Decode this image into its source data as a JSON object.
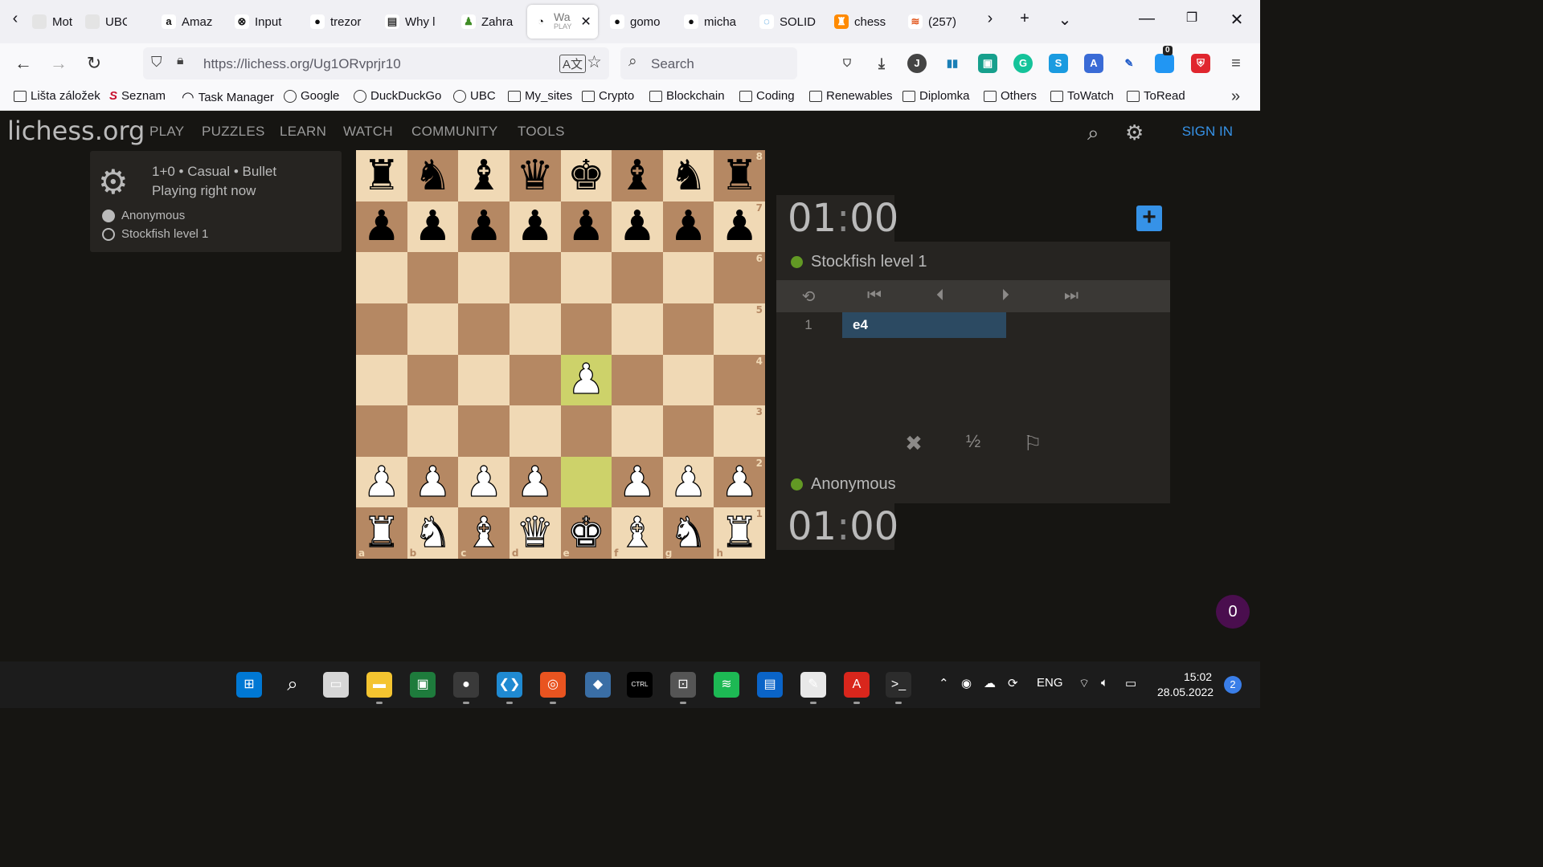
{
  "browser": {
    "tabs": [
      {
        "label": "Moto",
        "icon": "motor-icon",
        "color": "#ffffff"
      },
      {
        "label": "UBC",
        "icon": "ubc-icon",
        "color": "#ffffff"
      },
      {
        "label": "Amaz",
        "icon": "amazon-icon",
        "color": "#ffffff"
      },
      {
        "label": "Input",
        "icon": "github-icon",
        "color": "#ffffff"
      },
      {
        "label": "trezor",
        "icon": "github-icon",
        "color": "#ffffff"
      },
      {
        "label": "Why l",
        "icon": "book-icon",
        "color": "#ffffff"
      },
      {
        "label": "Zahra",
        "icon": "pawn-icon",
        "color": "#ffffff"
      },
      {
        "label": "Wa",
        "sublabel": "PLAY",
        "icon": "lichess-icon",
        "active": true
      },
      {
        "label": "gomo",
        "icon": "github-icon"
      },
      {
        "label": "micha",
        "icon": "github-icon"
      },
      {
        "label": "SOLID",
        "icon": "solid-icon"
      },
      {
        "label": "chess",
        "icon": "chess-icon"
      },
      {
        "label": "(257)",
        "icon": "flame-icon"
      }
    ],
    "url": "https://lichess.org/Ug1ORvprjr10",
    "search_placeholder": "Search",
    "extension_badge": "0",
    "bookmarks": [
      {
        "label": "Lišta záložek",
        "icon": "folder-icon"
      },
      {
        "label": "Seznam",
        "icon": "seznam-icon"
      },
      {
        "label": "Task Manager",
        "icon": "gauge-icon"
      },
      {
        "label": "Google",
        "icon": "globe-icon"
      },
      {
        "label": "DuckDuckGo",
        "icon": "globe-icon"
      },
      {
        "label": "UBC",
        "icon": "globe-icon"
      },
      {
        "label": "My_sites",
        "icon": "folder-icon"
      },
      {
        "label": "Crypto",
        "icon": "folder-icon"
      },
      {
        "label": "Blockchain",
        "icon": "folder-icon"
      },
      {
        "label": "Coding",
        "icon": "folder-icon"
      },
      {
        "label": "Renewables",
        "icon": "folder-icon"
      },
      {
        "label": "Diplomka",
        "icon": "folder-icon"
      },
      {
        "label": "Others",
        "icon": "folder-icon"
      },
      {
        "label": "ToWatch",
        "icon": "folder-icon"
      },
      {
        "label": "ToRead",
        "icon": "folder-icon"
      }
    ]
  },
  "site": {
    "logo": "lichess.org",
    "menu": [
      "PLAY",
      "PUZZLES",
      "LEARN",
      "WATCH",
      "COMMUNITY",
      "TOOLS"
    ],
    "signin": "SIGN IN"
  },
  "game": {
    "line1": "1+0 • Casual • Bullet",
    "line2": "Playing right now",
    "white_player": "Anonymous",
    "black_player": "Stockfish level 1",
    "top_clock_min": "01",
    "top_clock_sec": "00",
    "bottom_clock_min": "01",
    "bottom_clock_sec": "00",
    "top_player": "Stockfish level 1",
    "bottom_player": "Anonymous",
    "moves": [
      {
        "number": "1",
        "white": "e4"
      }
    ],
    "draw_label": "½",
    "chat_badge": "0"
  },
  "board": {
    "ranks": [
      "8",
      "7",
      "6",
      "5",
      "4",
      "3",
      "2",
      "1"
    ],
    "files": [
      "a",
      "b",
      "c",
      "d",
      "e",
      "f",
      "g",
      "h"
    ],
    "position": [
      [
        "bR",
        "bN",
        "bB",
        "bQ",
        "bK",
        "bB",
        "bN",
        "bR"
      ],
      [
        "bP",
        "bP",
        "bP",
        "bP",
        "bP",
        "bP",
        "bP",
        "bP"
      ],
      [
        "",
        "",
        "",
        "",
        "",
        "",
        "",
        ""
      ],
      [
        "",
        "",
        "",
        "",
        "",
        "",
        "",
        ""
      ],
      [
        "",
        "",
        "",
        "",
        "wP",
        "",
        "",
        ""
      ],
      [
        "",
        "",
        "",
        "",
        "",
        "",
        "",
        ""
      ],
      [
        "wP",
        "wP",
        "wP",
        "wP",
        "",
        "wP",
        "wP",
        "wP"
      ],
      [
        "wR",
        "wN",
        "wB",
        "wQ",
        "wK",
        "wB",
        "wN",
        "wR"
      ]
    ],
    "last_move": [
      "e2",
      "e4"
    ],
    "light_color": "#f0d9b5",
    "dark_color": "#b58863",
    "highlight_color": "#cdd26a"
  },
  "taskbar": {
    "apps": [
      "windows-start-icon",
      "search-icon",
      "task-view-icon",
      "file-explorer-icon",
      "photos-icon",
      "firefox-icon",
      "vscode-icon",
      "ubuntu-icon",
      "python-icon",
      "terminal-ctrl-icon",
      "network-icon",
      "spotify-icon",
      "app-icon",
      "paint-icon",
      "acrobat-icon",
      "cmd-icon"
    ],
    "language": "ENG",
    "time": "15:02",
    "date": "28.05.2022",
    "notifications": "2"
  }
}
